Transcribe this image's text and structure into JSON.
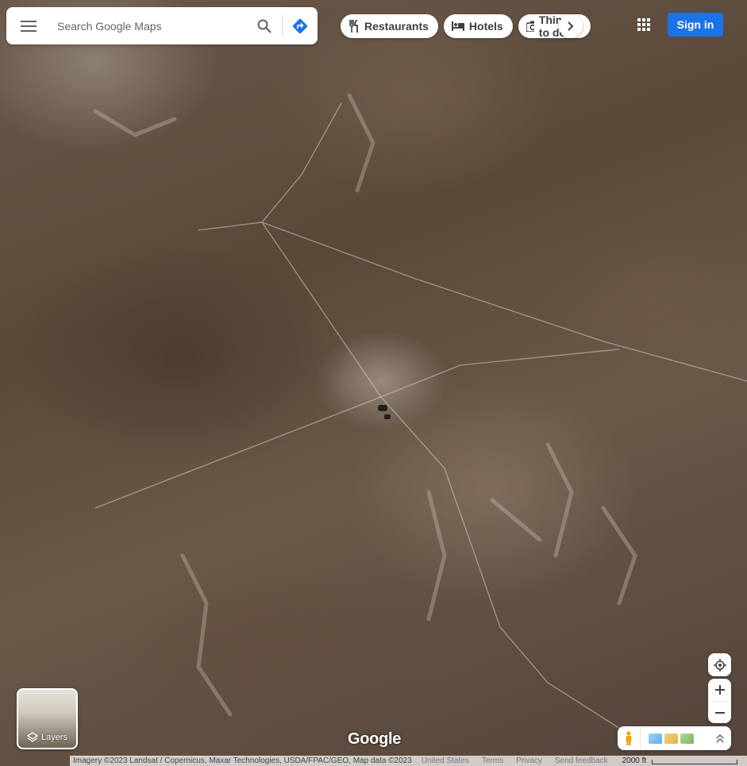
{
  "search": {
    "placeholder": "Search Google Maps"
  },
  "chips": [
    {
      "label": "Restaurants",
      "icon": "restaurant-icon"
    },
    {
      "label": "Hotels",
      "icon": "hotel-icon"
    },
    {
      "label": "Things to do",
      "icon": "camera-icon"
    }
  ],
  "header": {
    "signin_label": "Sign in"
  },
  "layers": {
    "label": "Layers"
  },
  "logo": {
    "text": "Google"
  },
  "footer": {
    "attribution": "Imagery ©2023 Landsat / Copernicus, Maxar Technologies, USDA/FPAC/GEO, Map data ©2023",
    "country": "United States",
    "terms": "Terms",
    "privacy": "Privacy",
    "feedback": "Send feedback",
    "scale": "2000 ft"
  },
  "colors": {
    "accent": "#1a73e8",
    "directions": "#1a73e8"
  }
}
